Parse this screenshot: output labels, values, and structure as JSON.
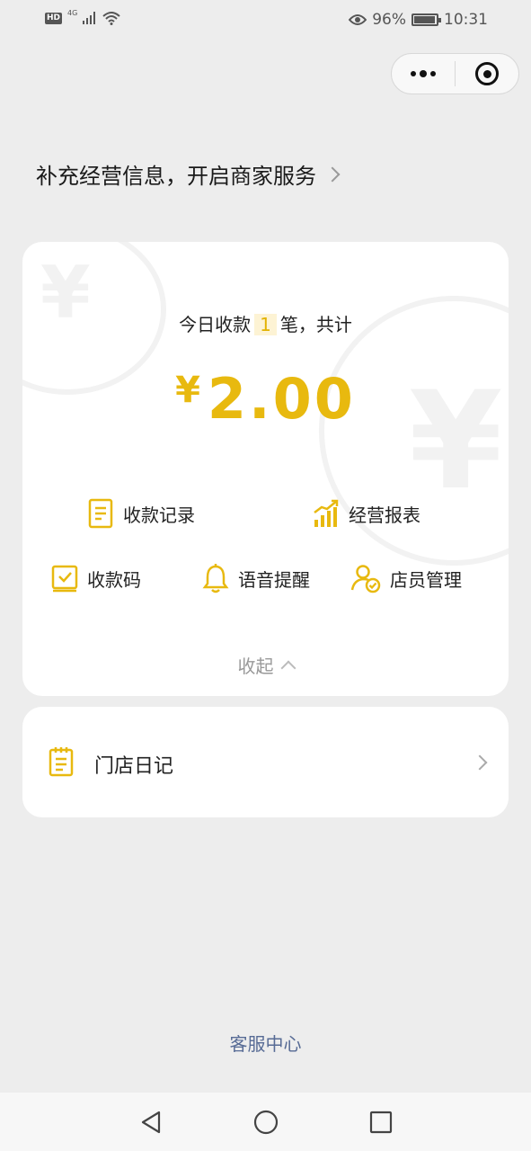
{
  "status_bar": {
    "hd": "HD",
    "network": "4G",
    "battery": "96%",
    "battery_level": 0.96,
    "time": "10:31"
  },
  "capsule": {
    "more_icon": "more-dots-icon",
    "close_icon": "target-close-icon"
  },
  "banner": {
    "text": "补充经营信息，开启商家服务"
  },
  "summary": {
    "prefix": "今日收款",
    "count": "1",
    "suffix": "笔，共计",
    "currency": "¥",
    "amount": "2.00"
  },
  "actions": {
    "records": "收款记录",
    "reports": "经营报表",
    "qrcode": "收款码",
    "voice": "语音提醒",
    "staff": "店员管理"
  },
  "collapse": {
    "label": "收起"
  },
  "diary": {
    "label": "门店日记"
  },
  "service": {
    "label": "客服中心"
  },
  "colors": {
    "accent": "#e8b90f",
    "link": "#576b95",
    "background": "#ededed"
  }
}
